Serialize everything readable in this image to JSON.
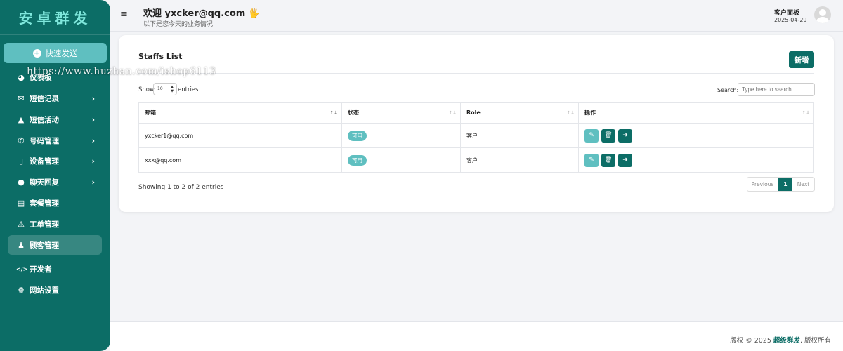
{
  "brand": "安卓群发",
  "watermark": "https://www.huzhan.com/ishop6113",
  "sidebar": {
    "quick_send": "快速发送",
    "items": [
      {
        "label": "仪表板",
        "icon": "dashboard-icon",
        "glyph": "◕"
      },
      {
        "label": "短信记录",
        "icon": "envelope-icon",
        "glyph": "✉"
      },
      {
        "label": "短信活动",
        "icon": "flask-icon",
        "glyph": "▲"
      },
      {
        "label": "号码管理",
        "icon": "phone-icon",
        "glyph": "✆"
      },
      {
        "label": "设备管理",
        "icon": "mobile-icon",
        "glyph": "▯"
      },
      {
        "label": "聊天回复",
        "icon": "chat-icon",
        "glyph": "●"
      },
      {
        "label": "套餐管理",
        "icon": "file-icon",
        "glyph": "▤"
      },
      {
        "label": "工单管理",
        "icon": "warning-icon",
        "glyph": "⚠"
      },
      {
        "label": "顾客管理",
        "icon": "user-plus-icon",
        "glyph": "♟"
      },
      {
        "label": "开发者",
        "icon": "code-icon",
        "glyph": "</>"
      },
      {
        "label": "网站设置",
        "icon": "gear-icon",
        "glyph": "⚙"
      }
    ],
    "active_index": 8,
    "chevron": "›"
  },
  "header": {
    "welcome": "欢迎 yxcker@qq.com 🖐",
    "subtitle": "以下是您今天的业务情况",
    "panel_label": "客户面板",
    "date": "2025-04-29"
  },
  "card": {
    "title": "Staffs List",
    "add_button": "新增",
    "show_label": "Show",
    "entries_value": "10",
    "entries_label": "entries",
    "search_label": "Search:",
    "search_placeholder": "Type here to search ...",
    "columns": [
      "邮箱",
      "状态",
      "Role",
      "操作"
    ],
    "rows": [
      {
        "email": "yxcker1@qq.com",
        "status": "可用",
        "role": "客户"
      },
      {
        "email": "xxx@qq.com",
        "status": "可用",
        "role": "客户"
      }
    ],
    "showing": "Showing 1 to 2 of 2 entries",
    "pager": {
      "prev": "Previous",
      "current": "1",
      "next": "Next"
    }
  },
  "footer": {
    "prefix": "版权 © 2025 ",
    "brand": "超级群发",
    "suffix": ". 版权所有."
  },
  "colors": {
    "primary": "#0c6d66",
    "accent": "#5fbfc0",
    "brand_text": "#7fe7dc"
  }
}
